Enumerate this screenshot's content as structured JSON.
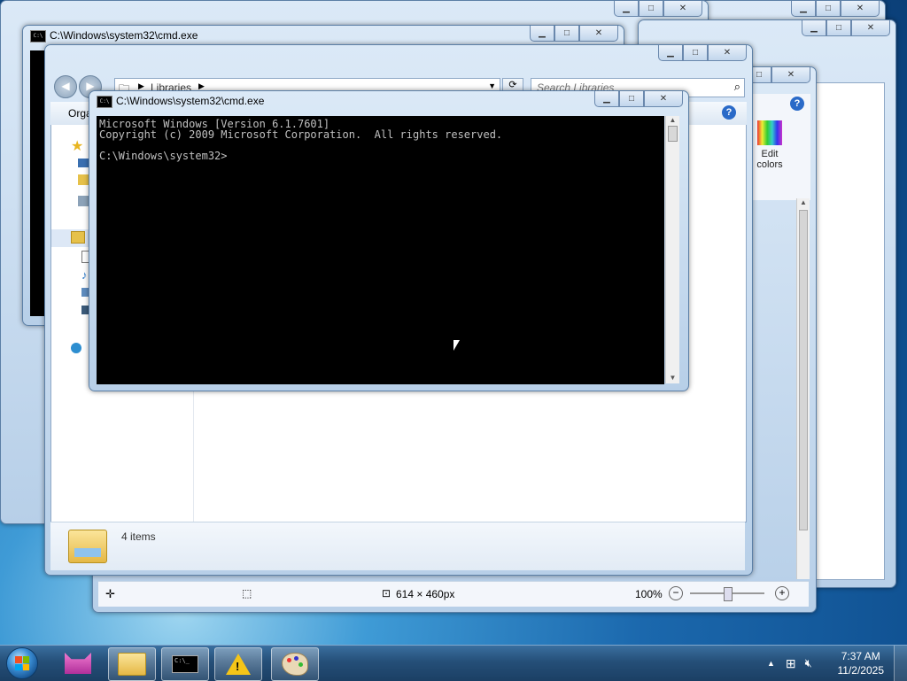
{
  "windows": {
    "cmd_front": {
      "title": "C:\\Windows\\system32\\cmd.exe",
      "lines": [
        "Microsoft Windows [Version 6.1.7601]",
        "Copyright (c) 2009 Microsoft Corporation.  All rights reserved.",
        "",
        "C:\\Windows\\system32>"
      ]
    },
    "cmd_back": {
      "title": "C:\\Windows\\system32\\cmd.exe"
    },
    "explorer": {
      "breadcrumb_root": "Libraries",
      "search_placeholder": "Search Libraries",
      "organize_label": "Orga",
      "status_items": "4 items"
    },
    "paint": {
      "edit_colors_label": "Edit colors",
      "dimensions": "614 × 460px",
      "zoom": "100%"
    }
  },
  "taskbar": {
    "time": "7:37 AM",
    "date": "11/2/2025",
    "apps": [
      "Libraries",
      "cmd.exe",
      "Warning",
      "Paint"
    ]
  },
  "colors": {
    "taskbar": "#254f78",
    "console_bg": "#000000",
    "console_fg": "#c0c0c0",
    "window_frame": "#c7dcf0"
  }
}
